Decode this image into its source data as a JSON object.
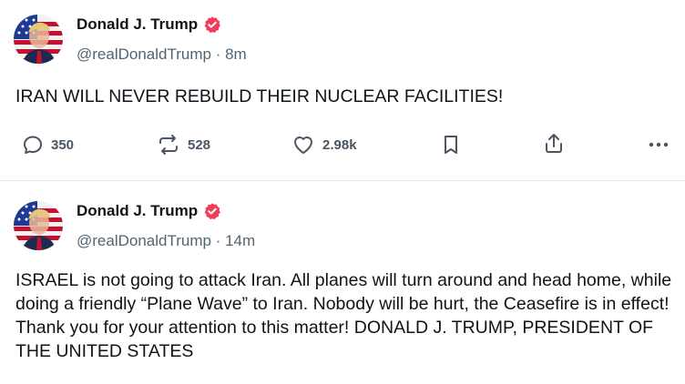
{
  "posts": [
    {
      "author": {
        "name": "Donald J. Trump",
        "handle": "@realDonaldTrump",
        "verified_icon": "verified-badge-icon"
      },
      "time": "8m",
      "text": "IRAN WILL NEVER REBUILD THEIR NUCLEAR FACILITIES!",
      "actions": {
        "replies": "350",
        "reposts": "528",
        "likes": "2.98k"
      }
    },
    {
      "author": {
        "name": "Donald J. Trump",
        "handle": "@realDonaldTrump",
        "verified_icon": "verified-badge-icon"
      },
      "time": "14m",
      "text": "ISRAEL is not going to attack Iran. All planes will turn around and head home, while doing a friendly “Plane Wave” to Iran. Nobody will be hurt, the Ceasefire is in effect! Thank you for your attention to this matter! DONALD J. TRUMP, PRESIDENT OF THE UNITED STATES"
    }
  ],
  "separator": " · ",
  "colors": {
    "verified": "#f03e5a",
    "action_icon": "#4b5563",
    "border": "#e7e9ec",
    "handle": "#536471"
  }
}
